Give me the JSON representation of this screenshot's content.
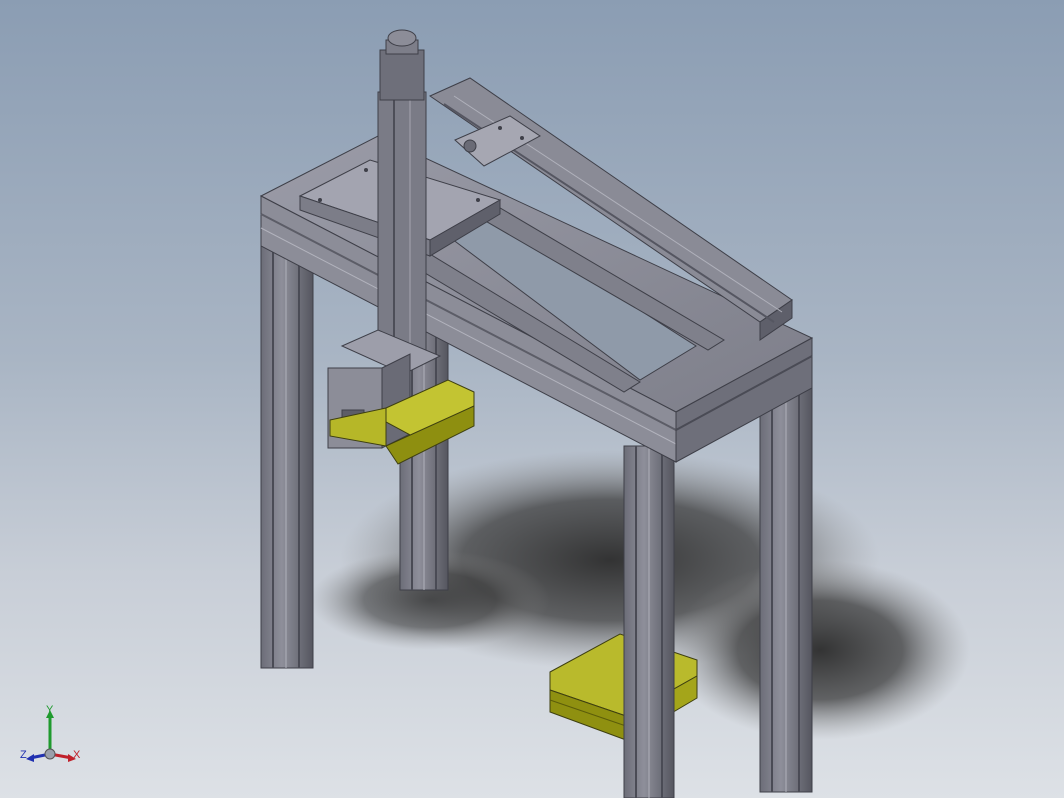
{
  "window": {
    "title": "",
    "background_top": "#8b9db3",
    "background_bottom": "#dde1e6"
  },
  "model": {
    "frame_color": "#7c7d88",
    "frame_shade": "#5a5b66",
    "frame_dark": "#3e3f48",
    "plate_color": "#a8a8b4",
    "part_color": "#9a9b12",
    "part_highlight": "#c7c838",
    "shadow_color": "#2e2e2e"
  },
  "triad": {
    "x_label": "X",
    "y_label": "Y",
    "z_label": "Z",
    "x_color": "#c0202a",
    "y_color": "#1f9a2e",
    "z_color": "#2030b0"
  }
}
